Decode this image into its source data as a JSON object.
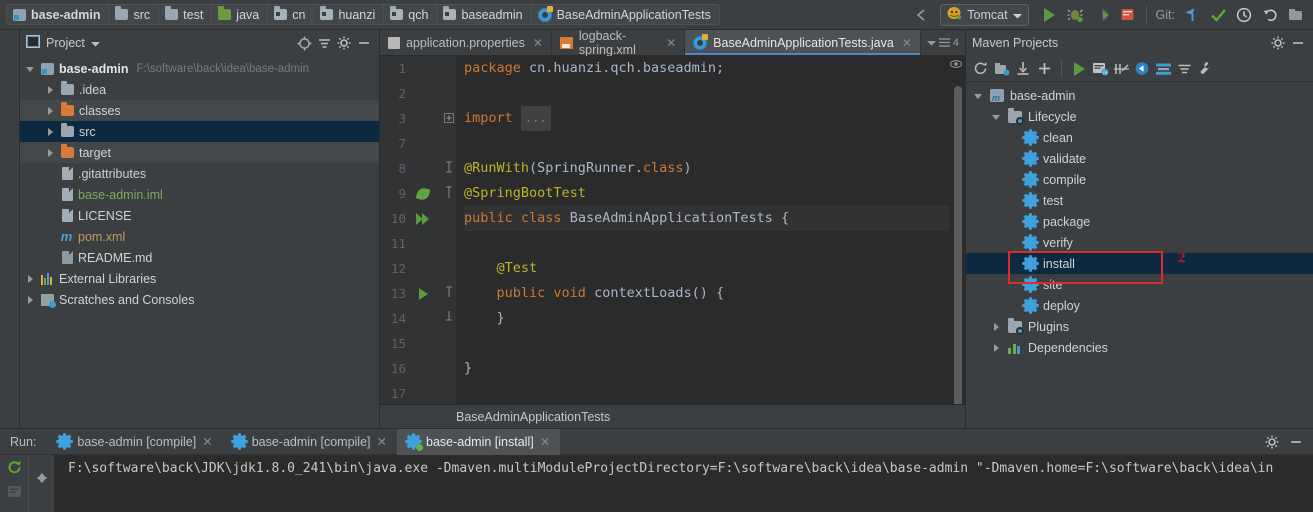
{
  "breadcrumbs": [
    {
      "label": "base-admin",
      "icon": "module-icon",
      "bold": true
    },
    {
      "label": "src",
      "icon": "folder-icon"
    },
    {
      "label": "test",
      "icon": "folder-icon"
    },
    {
      "label": "java",
      "icon": "source-folder-icon"
    },
    {
      "label": "cn",
      "icon": "package-icon"
    },
    {
      "label": "huanzi",
      "icon": "package-icon"
    },
    {
      "label": "qch",
      "icon": "package-icon"
    },
    {
      "label": "baseadmin",
      "icon": "package-icon"
    },
    {
      "label": "BaseAdminApplicationTests",
      "icon": "java-class-icon"
    }
  ],
  "toolbar": {
    "run_config": "Tomcat",
    "run_config_icon": "tomcat-icon",
    "back_icon": "back-arrow-icon",
    "run_icon": "run-icon",
    "debug_icon": "debug-icon",
    "run_coverage_icon": "run-with-coverage-icon",
    "stop_icon": "stop-icon",
    "git_label": "Git:",
    "git_update_icon": "update-project-icon",
    "git_commit_icon": "commit-icon",
    "git_history_icon": "history-icon",
    "git_rollback_icon": "rollback-icon",
    "settings_icon": "settings-icon"
  },
  "project_panel": {
    "title": "Project",
    "dropdown_icon": "chevron-down-icon",
    "locate_icon": "locate-icon",
    "collapse_icon": "collapse-all-icon",
    "gear_icon": "gear-icon",
    "hide_icon": "hide-icon",
    "tree": [
      {
        "label": "base-admin",
        "path": "F:\\software\\back\\idea\\base-admin",
        "icon": "module-icon",
        "indent": 0,
        "arrow": "open",
        "style": "bold",
        "state": "normal"
      },
      {
        "label": ".idea",
        "icon": "folder-icon",
        "indent": 1,
        "arrow": "closed",
        "state": "normal"
      },
      {
        "label": "classes",
        "icon": "folder-orange-icon",
        "indent": 1,
        "arrow": "closed",
        "state": "highlight"
      },
      {
        "label": "src",
        "icon": "folder-icon",
        "indent": 1,
        "arrow": "closed",
        "state": "selected"
      },
      {
        "label": "target",
        "icon": "folder-orange-icon",
        "indent": 1,
        "arrow": "closed",
        "state": "highlight"
      },
      {
        "label": ".gitattributes",
        "icon": "file-icon",
        "indent": 2,
        "arrow": "none",
        "state": "normal"
      },
      {
        "label": "base-admin.iml",
        "icon": "iml-file-icon",
        "indent": 2,
        "arrow": "none",
        "style": "green",
        "state": "normal"
      },
      {
        "label": "LICENSE",
        "icon": "file-icon",
        "indent": 2,
        "arrow": "none",
        "state": "normal"
      },
      {
        "label": "pom.xml",
        "icon": "maven-pom-icon",
        "indent": 2,
        "arrow": "none",
        "style": "tan",
        "state": "normal"
      },
      {
        "label": "README.md",
        "icon": "markdown-file-icon",
        "indent": 2,
        "arrow": "none",
        "state": "normal"
      },
      {
        "label": "External Libraries",
        "icon": "libraries-icon",
        "indent": 0,
        "arrow": "closed",
        "state": "normal"
      },
      {
        "label": "Scratches and Consoles",
        "icon": "scratches-icon",
        "indent": 0,
        "arrow": "closed",
        "state": "normal"
      }
    ]
  },
  "editor": {
    "tabs": [
      {
        "label": "application.properties",
        "icon": "properties-file-icon",
        "active": false
      },
      {
        "label": "logback-spring.xml",
        "icon": "xml-file-icon",
        "active": false
      },
      {
        "label": "BaseAdminApplicationTests.java",
        "icon": "java-class-icon",
        "active": true
      }
    ],
    "tab_overflow_label": "4",
    "breadcrumb_status": "BaseAdminApplicationTests",
    "eye_icon": "preview-eye-icon",
    "lines": [
      {
        "num": "1",
        "text": "package cn.huanzi.qch.baseadmin;",
        "gutter": ""
      },
      {
        "num": "2",
        "text": "",
        "gutter": ""
      },
      {
        "num": "3",
        "text": "import ...",
        "gutter": "",
        "fold": "plus"
      },
      {
        "num": "7",
        "text": "",
        "gutter": ""
      },
      {
        "num": "8",
        "text": "@RunWith(SpringRunner.class)",
        "gutter": "",
        "fold": "minus"
      },
      {
        "num": "9",
        "text": "@SpringBootTest",
        "gutter": "spring-leaf-icon",
        "fold": "minus"
      },
      {
        "num": "10",
        "text": "public class BaseAdminApplicationTests {",
        "gutter": "run-all-tests-icon",
        "highlight": true
      },
      {
        "num": "11",
        "text": "",
        "gutter": ""
      },
      {
        "num": "12",
        "text": "    @Test",
        "gutter": ""
      },
      {
        "num": "13",
        "text": "    public void contextLoads() {",
        "gutter": "run-test-icon",
        "fold": "minus"
      },
      {
        "num": "14",
        "text": "    }",
        "gutter": "",
        "fold": "end"
      },
      {
        "num": "15",
        "text": "",
        "gutter": ""
      },
      {
        "num": "16",
        "text": "}",
        "gutter": ""
      },
      {
        "num": "17",
        "text": "",
        "gutter": ""
      }
    ]
  },
  "maven_panel": {
    "title": "Maven Projects",
    "gear_icon": "gear-icon",
    "hide_icon": "hide-icon",
    "toolbar_icons": [
      "reimport-icon",
      "generate-sources-icon",
      "download-sources-icon",
      "add-maven-project-icon",
      "run-maven-build-icon",
      "execute-goal-icon",
      "toggle-skip-tests-icon",
      "toggle-offline-icon",
      "show-dependencies-icon",
      "collapse-all-icon",
      "maven-settings-icon"
    ],
    "tree": [
      {
        "label": "base-admin",
        "icon": "maven-project-icon",
        "indent": 0,
        "arrow": "open"
      },
      {
        "label": "Lifecycle",
        "icon": "lifecycle-icon",
        "indent": 1,
        "arrow": "open"
      },
      {
        "label": "clean",
        "icon": "maven-goal-icon",
        "indent": 2,
        "arrow": "none"
      },
      {
        "label": "validate",
        "icon": "maven-goal-icon",
        "indent": 2,
        "arrow": "none"
      },
      {
        "label": "compile",
        "icon": "maven-goal-icon",
        "indent": 2,
        "arrow": "none"
      },
      {
        "label": "test",
        "icon": "maven-goal-icon",
        "indent": 2,
        "arrow": "none"
      },
      {
        "label": "package",
        "icon": "maven-goal-icon",
        "indent": 2,
        "arrow": "none"
      },
      {
        "label": "verify",
        "icon": "maven-goal-icon",
        "indent": 2,
        "arrow": "none"
      },
      {
        "label": "install",
        "icon": "maven-goal-icon",
        "indent": 2,
        "arrow": "none",
        "selected": true
      },
      {
        "label": "site",
        "icon": "maven-goal-icon",
        "indent": 2,
        "arrow": "none"
      },
      {
        "label": "deploy",
        "icon": "maven-goal-icon",
        "indent": 2,
        "arrow": "none"
      },
      {
        "label": "Plugins",
        "icon": "plugins-icon",
        "indent": 1,
        "arrow": "closed"
      },
      {
        "label": "Dependencies",
        "icon": "dependencies-icon",
        "indent": 1,
        "arrow": "closed"
      }
    ],
    "annotation_number": "2",
    "annotation_color": "#e02b2b"
  },
  "run_panel": {
    "label": "Run:",
    "tabs": [
      {
        "label": "base-admin [compile]",
        "icon": "maven-goal-icon",
        "active": false
      },
      {
        "label": "base-admin [compile]",
        "icon": "maven-goal-icon",
        "active": false
      },
      {
        "label": "base-admin [install]",
        "icon": "maven-goal-running-icon",
        "active": true
      }
    ],
    "gear_icon": "gear-icon",
    "hide_icon": "hide-icon",
    "rerun_icon": "rerun-icon",
    "stop_icon": "stop-icon",
    "up_icon": "scroll-up-icon",
    "down_icon": "scroll-down-icon",
    "console_line": "F:\\software\\back\\JDK\\jdk1.8.0_241\\bin\\java.exe -Dmaven.multiModuleProjectDirectory=F:\\software\\back\\idea\\base-admin \"-Dmaven.home=F:\\software\\back\\idea\\in"
  },
  "colors": {
    "accent_blue": "#3b9dd6",
    "selection": "#0d293f",
    "run_green": "#5b9a3e",
    "annotation_red": "#e02b2b",
    "editor_bg": "#2b2b2b",
    "panel_bg": "#3c3f41"
  }
}
